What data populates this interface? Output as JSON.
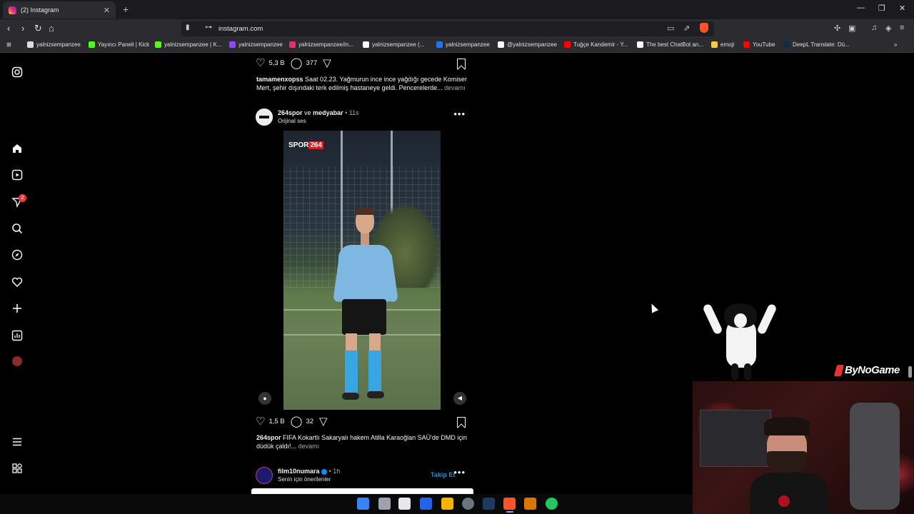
{
  "browser": {
    "tab_title": "(2) Instagram",
    "url": "instagram.com",
    "bookmarks": [
      {
        "label": "yalnizsempanzee",
        "color": "#dddddd"
      },
      {
        "label": "Yayıncı Paneli | Kick",
        "color": "#53fc18"
      },
      {
        "label": "yalnizsempanzee | K...",
        "color": "#53fc18"
      },
      {
        "label": "yalnizsempanzee",
        "color": "#9146ff"
      },
      {
        "label": "yalnizsempanzee/in...",
        "color": "#e1306c"
      },
      {
        "label": "yalnizsempanzee (...",
        "color": "#ffffff"
      },
      {
        "label": "yalnizsempanzee",
        "color": "#1877f2"
      },
      {
        "label": "@yalnizsempanzee",
        "color": "#ffffff"
      },
      {
        "label": "Tuğçe Kandemir - Y...",
        "color": "#ff0000"
      },
      {
        "label": "The best ChatBot an...",
        "color": "#ffffff"
      },
      {
        "label": "emoji",
        "color": "#f7c948"
      },
      {
        "label": "YouTube",
        "color": "#ff0000"
      },
      {
        "label": "DeepL Translate: Dü...",
        "color": "#0f2b46"
      }
    ]
  },
  "sidebar": {
    "notifications_badge": "2",
    "icons": [
      "instagram-logo-icon",
      "home-icon",
      "reels-icon",
      "messages-icon",
      "search-icon",
      "explore-icon",
      "notifications-icon",
      "create-icon",
      "dashboard-icon",
      "profile-avatar",
      "menu-icon",
      "threads-icon"
    ]
  },
  "prev_post": {
    "likes": "5,3 B",
    "comments": "377",
    "caption_user": "tamamenxopss",
    "caption_text": "Saat 02.23. Yağmurun ince ince yağdığı gecede Komiser Mert, şehir dışındaki terk edilmiş hastaneye geldi. Pencerelerde...",
    "more": "devamı"
  },
  "post": {
    "user": "264spor",
    "connector": "ve",
    "collab": "medyabar",
    "time": "• 11s",
    "audio": "Orijinal ses",
    "video_logo_text": "SPOR",
    "video_logo_num": "264",
    "likes": "1,5 B",
    "comments": "32",
    "caption_user": "264spor",
    "caption_text": "FIFA Kokartlı Sakaryalı hakem Atilla Karaoğlan SAÜ'de DMD için düdük çaldı!...",
    "more": "devamı"
  },
  "next_post": {
    "user": "film10numara",
    "time": "• 1h",
    "subtitle": "Senin için önerilenler",
    "follow_label": "Takip Et"
  },
  "overlay": {
    "brand": "ByNoGame"
  }
}
